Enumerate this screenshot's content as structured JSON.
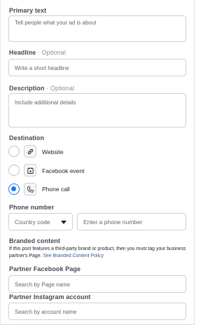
{
  "primary_text": {
    "label": "Primary text",
    "placeholder": "Tell people what your ad is about"
  },
  "headline": {
    "label": "Headline",
    "optional": " · Optional",
    "placeholder": "Write a short headline"
  },
  "description": {
    "label": "Description",
    "optional": " · Optional",
    "placeholder": "Include additional details"
  },
  "destination": {
    "label": "Destination",
    "options": [
      {
        "label": "Website",
        "icon": "link-icon",
        "selected": false
      },
      {
        "label": "Facebook event",
        "icon": "calendar-icon",
        "selected": false
      },
      {
        "label": "Phone call",
        "icon": "phone-icon",
        "selected": true
      }
    ]
  },
  "phone_number": {
    "label": "Phone number",
    "country_code": "Country code",
    "placeholder": "Enter a phone number"
  },
  "branded_content": {
    "label": "Branded content",
    "text": "If this post features a third-party brand or product, then you must tag your business partner's Page.",
    "link": "See Branded Content Policy"
  },
  "partner_facebook": {
    "label": "Partner Facebook Page",
    "placeholder": "Search by Page name"
  },
  "partner_instagram": {
    "label": "Partner Instagram account",
    "placeholder": "Search by account name"
  },
  "colors": {
    "accent": "#1877f2",
    "link": "#385898",
    "border": "#ccd0d5"
  }
}
